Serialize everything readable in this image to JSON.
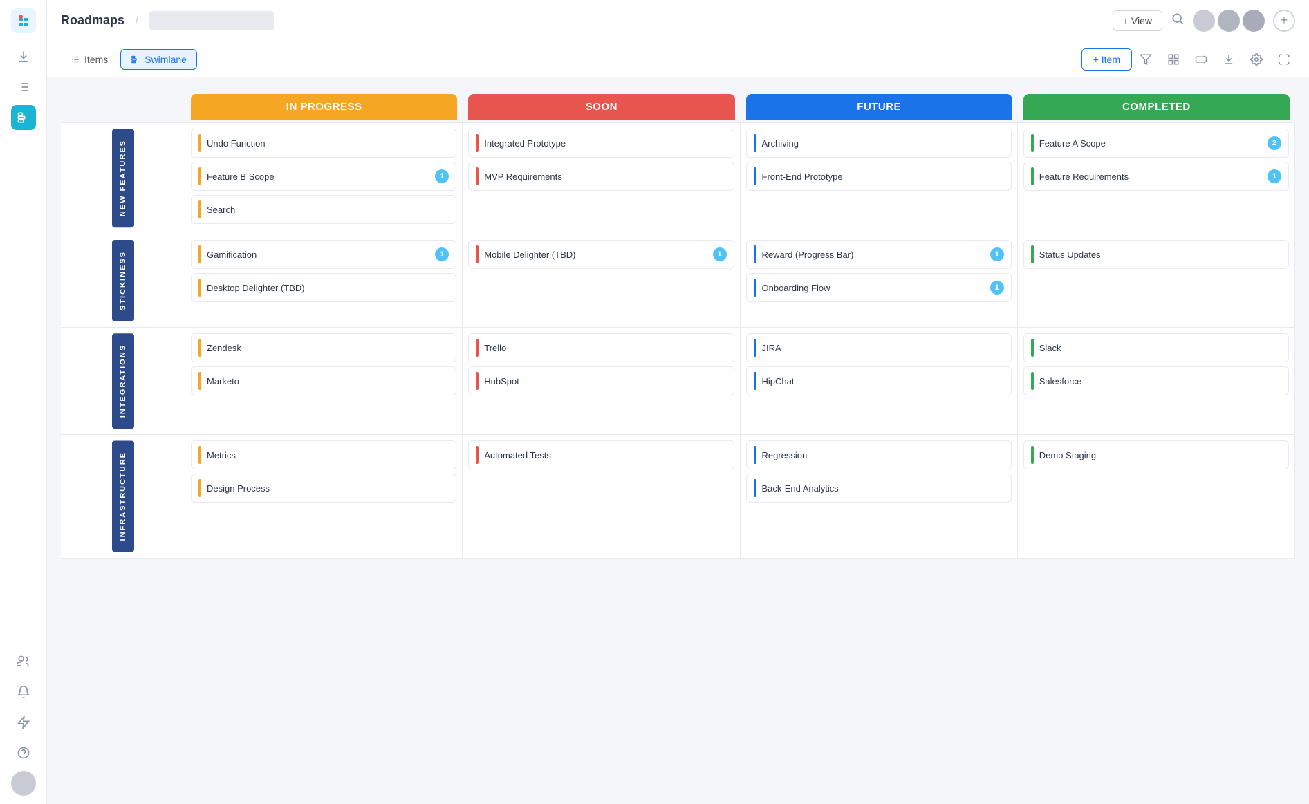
{
  "app": {
    "logo_color": "#e8f5fe",
    "title": "Roadmaps",
    "breadcrumb_placeholder": ""
  },
  "topbar": {
    "add_view_label": "+ View",
    "avatars": [
      "#c8cbd4",
      "#b0b5c0",
      "#a8acb8"
    ],
    "plus_label": "+"
  },
  "toolbar": {
    "tabs": [
      {
        "id": "items",
        "label": "Items",
        "active": false
      },
      {
        "id": "swimlane",
        "label": "Swimlane",
        "active": true
      }
    ],
    "add_item_label": "+ Item"
  },
  "columns": [
    {
      "id": "in-progress",
      "label": "IN PROGRESS",
      "class": "in-progress"
    },
    {
      "id": "soon",
      "label": "SOON",
      "class": "soon"
    },
    {
      "id": "future",
      "label": "FUTURE",
      "class": "future"
    },
    {
      "id": "completed",
      "label": "COMPLETED",
      "class": "completed"
    }
  ],
  "rows": [
    {
      "id": "new-features",
      "label": "NEW FEATURES",
      "cells": {
        "in-progress": [
          {
            "text": "Undo Function",
            "accent": "yellow",
            "badge": null
          },
          {
            "text": "Feature B Scope",
            "accent": "yellow",
            "badge": 1
          },
          {
            "text": "Search",
            "accent": "yellow",
            "badge": null
          }
        ],
        "soon": [
          {
            "text": "Integrated Prototype",
            "accent": "red",
            "badge": null
          },
          {
            "text": "MVP Requirements",
            "accent": "red",
            "badge": null
          }
        ],
        "future": [
          {
            "text": "Archiving",
            "accent": "blue",
            "badge": null
          },
          {
            "text": "Front-End Prototype",
            "accent": "blue",
            "badge": null
          }
        ],
        "completed": [
          {
            "text": "Feature A Scope",
            "accent": "green",
            "badge": 2
          },
          {
            "text": "Feature Requirements",
            "accent": "green",
            "badge": 1
          }
        ]
      }
    },
    {
      "id": "stickiness",
      "label": "STICKINESS",
      "cells": {
        "in-progress": [
          {
            "text": "Gamification",
            "accent": "yellow",
            "badge": 1
          },
          {
            "text": "Desktop Delighter (TBD)",
            "accent": "yellow",
            "badge": null
          }
        ],
        "soon": [
          {
            "text": "Mobile Delighter (TBD)",
            "accent": "red",
            "badge": 1
          }
        ],
        "future": [
          {
            "text": "Reward (Progress Bar)",
            "accent": "blue",
            "badge": 1
          },
          {
            "text": "Onboarding Flow",
            "accent": "blue",
            "badge": 1
          }
        ],
        "completed": [
          {
            "text": "Status Updates",
            "accent": "green",
            "badge": null
          }
        ]
      }
    },
    {
      "id": "integrations",
      "label": "INTEGRATIONS",
      "cells": {
        "in-progress": [
          {
            "text": "Zendesk",
            "accent": "yellow",
            "badge": null
          },
          {
            "text": "Marketo",
            "accent": "yellow",
            "badge": null
          }
        ],
        "soon": [
          {
            "text": "Trello",
            "accent": "red",
            "badge": null
          },
          {
            "text": "HubSpot",
            "accent": "red",
            "badge": null
          }
        ],
        "future": [
          {
            "text": "JIRA",
            "accent": "blue",
            "badge": null
          },
          {
            "text": "HipChat",
            "accent": "blue",
            "badge": null
          }
        ],
        "completed": [
          {
            "text": "Slack",
            "accent": "green",
            "badge": null
          },
          {
            "text": "Salesforce",
            "accent": "green",
            "badge": null
          }
        ]
      }
    },
    {
      "id": "infrastructure",
      "label": "INFRASTRUCTURE",
      "cells": {
        "in-progress": [
          {
            "text": "Metrics",
            "accent": "yellow",
            "badge": null
          },
          {
            "text": "Design Process",
            "accent": "yellow",
            "badge": null
          }
        ],
        "soon": [
          {
            "text": "Automated Tests",
            "accent": "red",
            "badge": null
          }
        ],
        "future": [
          {
            "text": "Regression",
            "accent": "blue",
            "badge": null
          },
          {
            "text": "Back-End Analytics",
            "accent": "blue",
            "badge": null
          }
        ],
        "completed": [
          {
            "text": "Demo Staging",
            "accent": "green",
            "badge": null
          }
        ]
      }
    }
  ],
  "icons": {
    "search": "🔍",
    "filter": "⚬",
    "grid": "⊞",
    "download": "↓",
    "settings": "⚙",
    "expand": "⤢",
    "list": "≡",
    "swimlane": "⊟",
    "plus": "+",
    "question": "?",
    "bell": "🔔",
    "lightning": "⚡",
    "user-add": "👤",
    "roadmap-icon": "≡"
  },
  "colors": {
    "in_progress": "#f5a623",
    "soon": "#e8554e",
    "future": "#1a73e8",
    "completed": "#34a853",
    "row_label_bg": "#2d4a8a",
    "badge": "#4fc3f7"
  }
}
